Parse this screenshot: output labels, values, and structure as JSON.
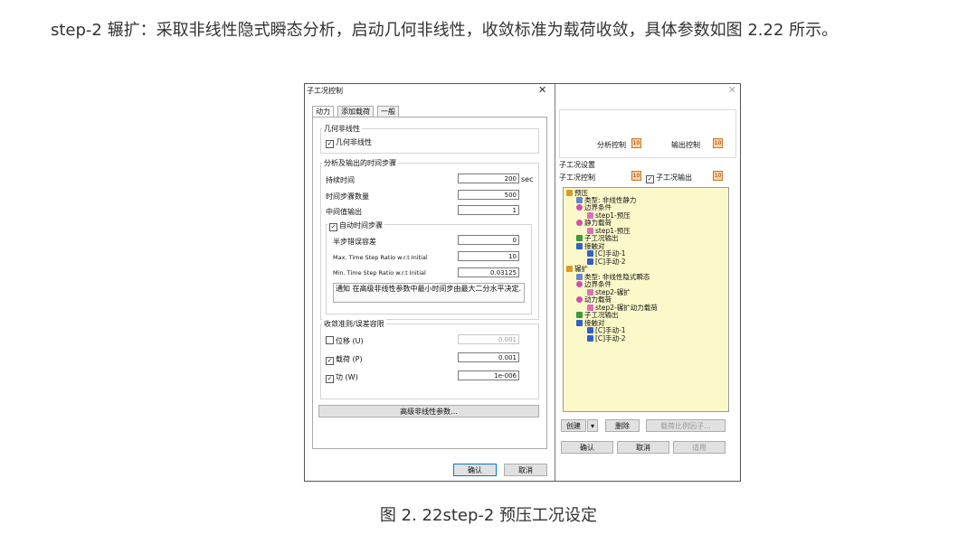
{
  "paragraph": "step-2 辗扩：采取非线性隐式瞬态分析，启动几何非线性，收敛标准为载荷收敛，具体参数如图 2.22 所示。",
  "caption": "图 2. 22step-2 预压工况设定",
  "dialog": {
    "title": "子工况控制",
    "close_glyph": "✕",
    "tabs": [
      "动力",
      "添加载荷",
      "一般"
    ],
    "geom_group": "几何非线性",
    "geom_check": "几何非线性",
    "time_group": "分析及输出的时间步骤",
    "duration_label": "持续时间",
    "duration_value": "200",
    "duration_unit": "sec",
    "steps_label": "时间步骤数量",
    "steps_value": "500",
    "mid_label": "中间值输出",
    "mid_value": "1",
    "auto_check": "自动时间步骤",
    "half_err_label": "半步错误容差",
    "half_err_value": "0",
    "max_ratio_label": "Max. Time Step Ratio w.r.t Initial",
    "max_ratio_value": "10",
    "min_ratio_label": "Min. Time Step Ratio w.r.t Initial",
    "min_ratio_value": "0.03125",
    "notice_text": "通知 在高级非线性参数中最小时间步由最大二分水平决定.",
    "conv_group": "收敛准则/误差容限",
    "disp_label": "位移 (U)",
    "disp_value": "0.001",
    "load_label": "载荷 (P)",
    "load_value": "0.001",
    "work_label": "功 (W)",
    "work_value": "1e-006",
    "advanced_button": "高级非线性参数...",
    "ok_button": "确认",
    "cancel_button": "取消"
  },
  "right": {
    "close_glyph": "✕",
    "analysis_control": "分析控制",
    "output_control": "输出控制",
    "group_label": "子工况设置",
    "subcase_control": "子工况控制",
    "subcase_output": "子工况输出",
    "tree": [
      {
        "text": "预压",
        "icon": "folder",
        "depth": 0
      },
      {
        "text": "类型: 非线性静力",
        "icon": "sheet",
        "depth": 1
      },
      {
        "text": "边界条件",
        "icon": "gear",
        "depth": 1
      },
      {
        "text": "step1-预压",
        "icon": "ref",
        "depth": 2
      },
      {
        "text": "静力载荷",
        "icon": "gear",
        "depth": 1
      },
      {
        "text": "step1-预压",
        "icon": "ref",
        "depth": 2
      },
      {
        "text": "子工况输出",
        "icon": "lock",
        "depth": 1
      },
      {
        "text": "接触对",
        "icon": "hourglass",
        "depth": 1
      },
      {
        "text": "[C]手动-1",
        "icon": "hourglass",
        "depth": 2
      },
      {
        "text": "[C]手动-2",
        "icon": "hourglass",
        "depth": 2
      },
      {
        "text": "辗扩",
        "icon": "folder",
        "depth": 0
      },
      {
        "text": "类型: 非线性隐式瞬态",
        "icon": "sheet",
        "depth": 1
      },
      {
        "text": "边界条件",
        "icon": "gear",
        "depth": 1
      },
      {
        "text": "step2-辗扩",
        "icon": "ref",
        "depth": 2
      },
      {
        "text": "动力载荷",
        "icon": "gear",
        "depth": 1
      },
      {
        "text": "step2-辗扩动力载荷",
        "icon": "ref",
        "depth": 2
      },
      {
        "text": "子工况输出",
        "icon": "lock",
        "depth": 1
      },
      {
        "text": "接触对",
        "icon": "hourglass",
        "depth": 1
      },
      {
        "text": "[C]手动-1",
        "icon": "hourglass",
        "depth": 2
      },
      {
        "text": "[C]手动-2",
        "icon": "hourglass",
        "depth": 2
      }
    ],
    "create_button": "创建",
    "delete_button": "删除",
    "load_factor_button": "载荷比例因子...",
    "ok_button": "确认",
    "cancel_button": "取消",
    "apply_button": "适用"
  }
}
